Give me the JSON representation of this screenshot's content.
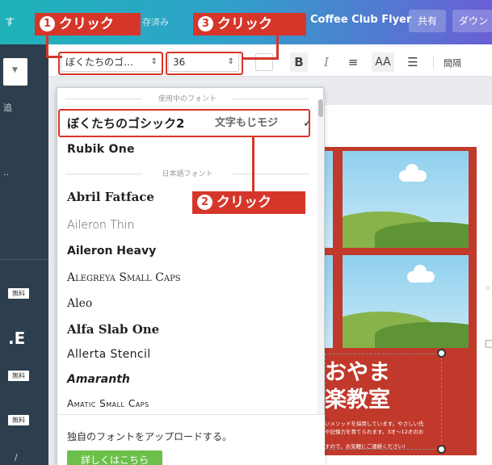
{
  "topbar": {
    "left_text": "す",
    "saved": "存済み",
    "title": "Coffee Club Flyer",
    "share": "共有",
    "download": "ダウン"
  },
  "sidebar": {
    "dropdown_arrow": "▼",
    "item_1": "追",
    "item_2": "..",
    "badge_1": "無料",
    "badge_2": "無料",
    "badge_3": "無料",
    "big_e": ".E",
    "bottom": "/"
  },
  "toolbar": {
    "font_value": "ぼくたちのゴ…",
    "font_arrow": "⇕",
    "size_value": "36",
    "size_arrow": "⇕",
    "bold": "B",
    "italic": "I",
    "align": "≡",
    "case": "AA",
    "list": "☰",
    "spacing": "間隔"
  },
  "dropdown": {
    "section_in_use": "使用中のフォント",
    "section_japanese": "日本語フォント",
    "selected": {
      "name": "ぼくたちのゴシック2",
      "sample": "文字もじモジ",
      "check": "✓"
    },
    "items": [
      "Rubik One",
      "Abril Fatface",
      "Aileron Thin",
      "Aileron Heavy",
      "Alegreya Small Caps",
      "Aleo",
      "Alfa Slab One",
      "Allerta Stencil",
      "Amaranth",
      "Amatic Small Caps"
    ],
    "upload_text": "独自のフォントをアップロードする。",
    "learn_more": "詳しくはこちら"
  },
  "poster": {
    "title_line1": "おやま",
    "title_line2": "楽教室",
    "desc_line1": "いメソッドを採用しています。やさしい先",
    "desc_line2": "や記憶力を育てられます。3才〜12才のお",
    "desc_line3": "すので、お気軽にご連絡ください!"
  },
  "annotations": {
    "step1": {
      "num": "1",
      "text": "クリック"
    },
    "step2": {
      "num": "2",
      "text": "クリック"
    },
    "step3": {
      "num": "3",
      "text": "クリック"
    }
  },
  "colors": {
    "annotation_red": "#d6362a",
    "poster_red": "#c0392b",
    "learn_button_green": "#6cc04a",
    "sidebar_dark": "#2d3e4e"
  }
}
